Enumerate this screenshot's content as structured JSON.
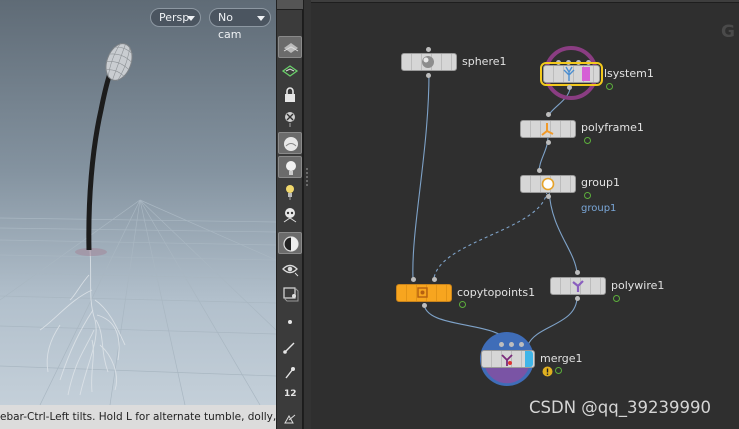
{
  "viewport": {
    "view_menu_label": "Persp",
    "camera_menu_label": "No cam",
    "status_text": "ebar-Ctrl-Left tilts. Hold L for alternate tumble, dolly,"
  },
  "toolbar": {
    "icons": [
      "display-options-icon",
      "ghost-geometry-icon",
      "lock-camera-icon",
      "snapping-icon",
      "shading-icon",
      "lighting-icon",
      "headlight-icon",
      "high-quality-light-icon",
      "shadows-icon",
      "visibility-icon",
      "bounding-box-icon",
      "point-display-icon",
      "normal-display-icon",
      "vector-display-icon",
      "point-number-icon",
      "primitive-number-icon"
    ],
    "point_number_label": "12"
  },
  "network": {
    "brand_text": "G",
    "nodes": [
      {
        "id": "sphere1",
        "label": "sphere1",
        "icon": "sphere-icon"
      },
      {
        "id": "lsystem1",
        "label": "lsystem1",
        "icon": "lsystem-icon",
        "state": "selected"
      },
      {
        "id": "polyframe1",
        "label": "polyframe1",
        "icon": "polyframe-icon"
      },
      {
        "id": "group1",
        "label": "group1",
        "icon": "group-icon",
        "sub_label": "group1"
      },
      {
        "id": "copytopoints1",
        "label": "copytopoints1",
        "icon": "copy-to-points-icon",
        "state": "bypassed"
      },
      {
        "id": "polywire1",
        "label": "polywire1",
        "icon": "polywire-icon"
      },
      {
        "id": "merge1",
        "label": "merge1",
        "icon": "merge-icon",
        "state": "display-flag"
      }
    ],
    "colors": {
      "background": "#2f2f2f",
      "wire": "#7ea2c8",
      "selected_outline": "#f3c91d",
      "bypass_node": "#f7a51f",
      "template_ring": "#8a3d82",
      "display_ring": "#3f6db8",
      "flag_green": "#5cae3c",
      "warning": "#e0b020"
    }
  },
  "watermark": "CSDN @qq_39239990"
}
